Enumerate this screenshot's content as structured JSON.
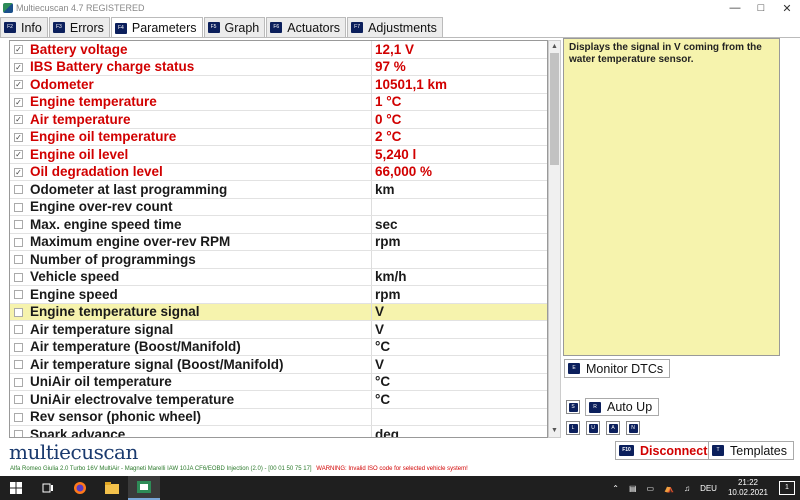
{
  "window": {
    "title": "Multiecuscan 4.7 REGISTERED"
  },
  "tabs": [
    {
      "key": "F2",
      "label": "Info"
    },
    {
      "key": "F3",
      "label": "Errors"
    },
    {
      "key": "F4",
      "label": "Parameters"
    },
    {
      "key": "F5",
      "label": "Graph"
    },
    {
      "key": "F6",
      "label": "Actuators"
    },
    {
      "key": "F7",
      "label": "Adjustments"
    }
  ],
  "parameters": [
    {
      "name": "Battery voltage",
      "value": "12,1 V",
      "checked": true
    },
    {
      "name": "IBS Battery charge status",
      "value": "97 %",
      "checked": true
    },
    {
      "name": "Odometer",
      "value": "10501,1 km",
      "checked": true
    },
    {
      "name": "Engine temperature",
      "value": "1 °C",
      "checked": true
    },
    {
      "name": "Air temperature",
      "value": "0 °C",
      "checked": true
    },
    {
      "name": "Engine oil temperature",
      "value": "2 °C",
      "checked": true
    },
    {
      "name": "Engine oil level",
      "value": "5,240 l",
      "checked": true
    },
    {
      "name": "Oil degradation level",
      "value": "66,000 %",
      "checked": true
    },
    {
      "name": "Odometer at last programming",
      "value": "km",
      "checked": false
    },
    {
      "name": "Engine over-rev count",
      "value": "",
      "checked": false
    },
    {
      "name": "Max. engine speed time",
      "value": "sec",
      "checked": false
    },
    {
      "name": "Maximum engine over-rev RPM",
      "value": "rpm",
      "checked": false
    },
    {
      "name": "Number of programmings",
      "value": "",
      "checked": false
    },
    {
      "name": "Vehicle speed",
      "value": "km/h",
      "checked": false
    },
    {
      "name": "Engine speed",
      "value": "rpm",
      "checked": false
    },
    {
      "name": "Engine temperature signal",
      "value": "V",
      "checked": false,
      "selected": true
    },
    {
      "name": "Air temperature signal",
      "value": "V",
      "checked": false
    },
    {
      "name": "Air temperature (Boost/Manifold)",
      "value": "°C",
      "checked": false
    },
    {
      "name": "Air temperature signal (Boost/Manifold)",
      "value": "V",
      "checked": false
    },
    {
      "name": "UniAir oil temperature",
      "value": "°C",
      "checked": false
    },
    {
      "name": "UniAir electrovalve temperature",
      "value": "°C",
      "checked": false
    },
    {
      "name": "Rev sensor (phonic wheel)",
      "value": "",
      "checked": false
    },
    {
      "name": "Spark advance",
      "value": "deg",
      "checked": false
    }
  ],
  "description": "Displays the signal in V coming from the water temperature sensor.",
  "buttons": {
    "monitor_dtcs": {
      "key": "E",
      "label": "Monitor DTCs"
    },
    "s_key": "S",
    "auto_up": {
      "key": "R",
      "label": "Auto Up"
    },
    "small_keys": [
      "L",
      "U",
      "A",
      "N"
    ],
    "disconnect": {
      "key": "F10",
      "label": "Disconnect"
    },
    "templates": {
      "key": "T",
      "label": "Templates"
    }
  },
  "logo": "multiecuscan",
  "status": {
    "vehicle": "Alfa Romeo Giulia 2.0 Turbo 16V MultiAir - Magneti Marelli IAW 10JA CF6/EOBD Injection (2.0) - [00 01 50 75 17]",
    "warning": "WARNING: Invalid ISO code for selected vehicle system!"
  },
  "taskbar": {
    "lang": "DEU",
    "time": "21:22",
    "date": "10.02.2021",
    "notifications": "1"
  },
  "colors": {
    "active_param": "#d10000",
    "selected_row": "#f6f3ad",
    "fkey_bg": "#0b1f5c"
  }
}
